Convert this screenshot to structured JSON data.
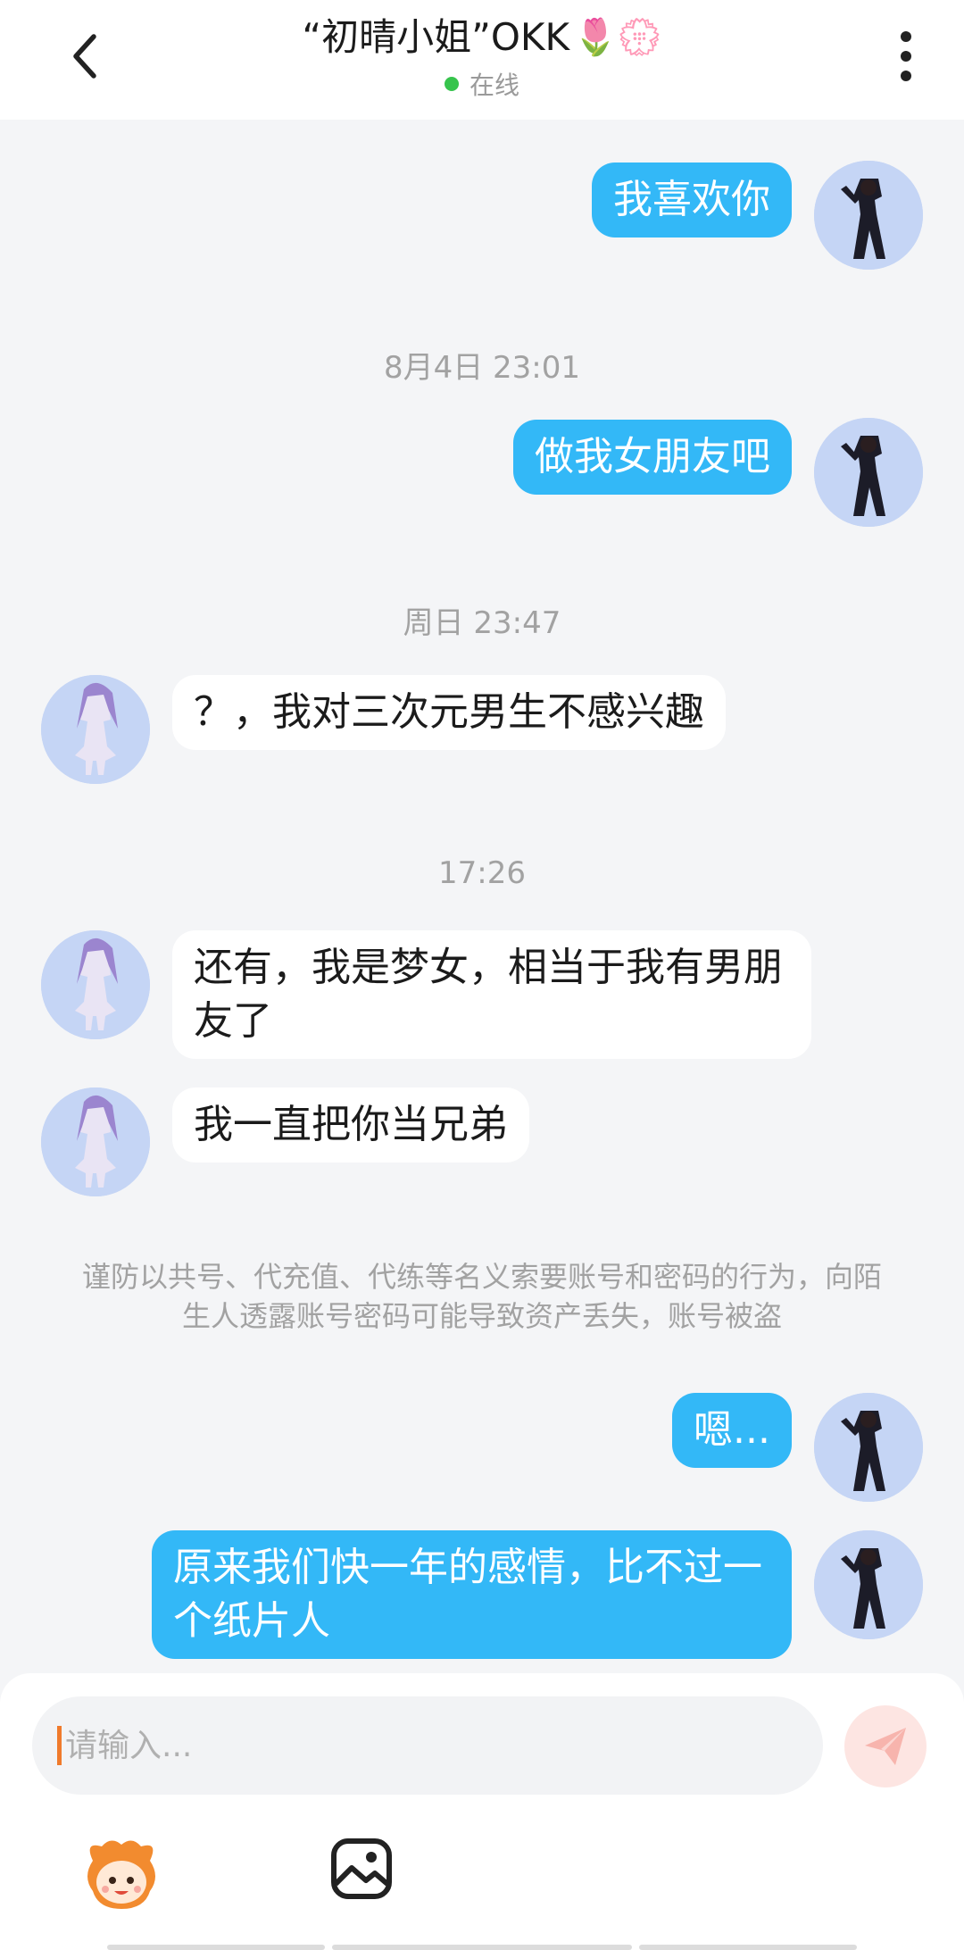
{
  "header": {
    "title": "“初晴小姐”OKK",
    "title_emoji": "🌷💮",
    "status": "在线",
    "status_color": "#37c44d",
    "back_icon": "chevron-left-icon",
    "more_icon": "more-vertical-icon"
  },
  "colors": {
    "bubble_me": "#33b8f7",
    "bubble_her": "#ffffff",
    "background": "#f4f5f7"
  },
  "messages": [
    {
      "sender": "me",
      "text": "我喜欢你"
    },
    {
      "type": "time",
      "text": "8月4日 23:01"
    },
    {
      "sender": "me",
      "text": "做我女朋友吧"
    },
    {
      "type": "time",
      "text": "周日 23:47"
    },
    {
      "sender": "her",
      "text": "？，我对三次元男生不感兴趣"
    },
    {
      "type": "time",
      "text": "17:26"
    },
    {
      "sender": "her",
      "text": "还有，我是梦女，相当于我有男朋友了"
    },
    {
      "sender": "her",
      "text": "我一直把你当兄弟"
    },
    {
      "type": "notice",
      "text": "谨防以共号、代充值、代练等名义索要账号和密码的行为，向陌生人透露账号密码可能导致资产丢失，账号被盗"
    },
    {
      "sender": "me",
      "text": "嗯..."
    },
    {
      "sender": "me",
      "text": "原来我们快一年的感情，比不过一个纸片人"
    }
  ],
  "input": {
    "placeholder": "请输入...",
    "value": ""
  },
  "toolbar": {
    "send_icon": "send-icon",
    "emoji_icon": "sticker-face-icon",
    "image_icon": "image-icon"
  }
}
